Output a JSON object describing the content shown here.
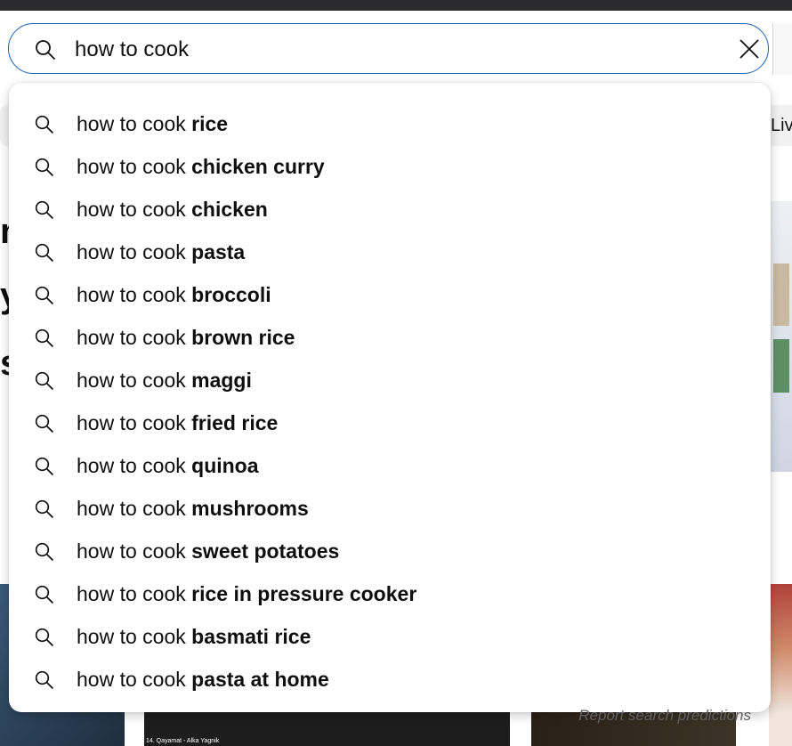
{
  "search": {
    "value": "how to cook",
    "icon": "search-icon",
    "clear_icon": "close-icon",
    "border_color": "#1c62b9"
  },
  "background": {
    "chip_right_label": "Liv",
    "big_letters": [
      "m",
      "y",
      "s"
    ],
    "bottom_mid_caption": "14. Qayamat - Alka Yagnik"
  },
  "suggestions": {
    "prefix": "how to cook ",
    "items": [
      {
        "completion": "rice"
      },
      {
        "completion": "chicken curry"
      },
      {
        "completion": "chicken"
      },
      {
        "completion": "pasta"
      },
      {
        "completion": "broccoli"
      },
      {
        "completion": "brown rice"
      },
      {
        "completion": "maggi"
      },
      {
        "completion": "fried rice"
      },
      {
        "completion": "quinoa"
      },
      {
        "completion": "mushrooms"
      },
      {
        "completion": "sweet potatoes"
      },
      {
        "completion": "rice in pressure cooker"
      },
      {
        "completion": "basmati rice"
      },
      {
        "completion": "pasta at home"
      }
    ],
    "report_label": "Report search predictions"
  }
}
